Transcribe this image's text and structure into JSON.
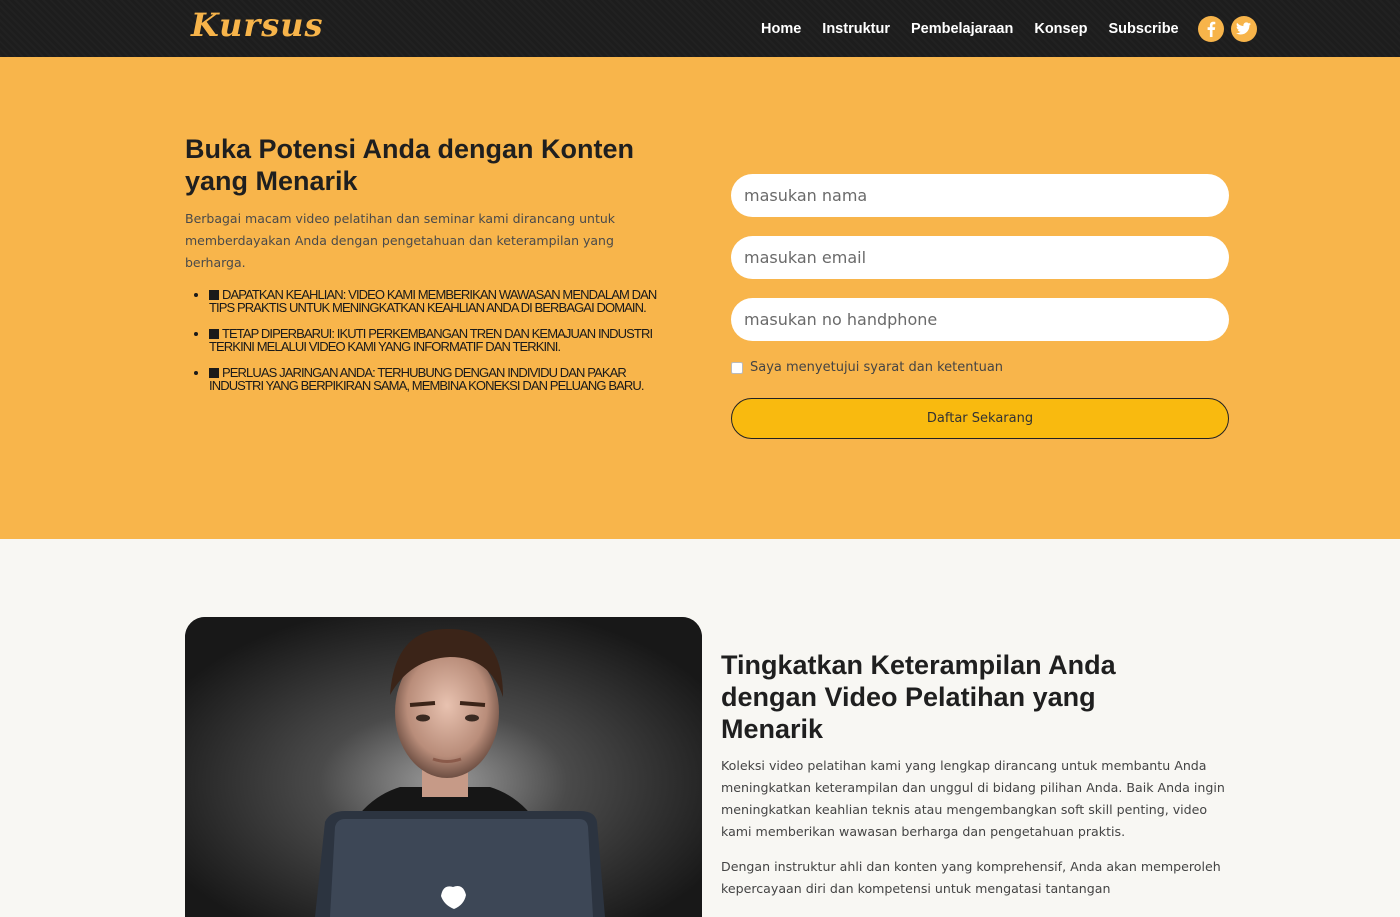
{
  "nav": {
    "logo": "Kursus",
    "links": [
      "Home",
      "Instruktur",
      "Pembelajaraan",
      "Konsep",
      "Subscribe"
    ],
    "social": [
      "facebook-icon",
      "twitter-icon"
    ]
  },
  "hero": {
    "title": "Buka Potensi Anda dengan Konten yang Menarik",
    "text": "Berbagai macam video pelatihan dan seminar kami dirancang untuk memberdayakan Anda dengan pengetahuan dan keterampilan yang berharga.",
    "list": [
      "DAPATKAN KEAHLIAN: VIDEO KAMI MEMBERIKAN WAWASAN MENDALAM DAN TIPS PRAKTIS UNTUK MENINGKATKAN KEAHLIAN ANDA DI BERBAGAI DOMAIN.",
      "TETAP DIPERBARUI: IKUTI PERKEMBANGAN TREN DAN KEMAJUAN INDUSTRI TERKINI MELALUI VIDEO KAMI YANG INFORMATIF DAN TERKINI.",
      "PERLUAS JARINGAN ANDA: TERHUBUNG DENGAN INDIVIDU DAN PAKAR INDUSTRI YANG BERPIKIRAN SAMA, MEMBINA KONEKSI DAN PELUANG BARU."
    ]
  },
  "form": {
    "name_placeholder": "masukan nama",
    "email_placeholder": "masukan email",
    "phone_placeholder": "masukan no handphone",
    "terms_label": "Saya menyetujui syarat dan ketentuan",
    "submit_label": "Daftar Sekarang"
  },
  "section2": {
    "title": "Tingkatkan Keterampilan Anda dengan Video Pelatihan yang Menarik",
    "p1": "Koleksi video pelatihan kami yang lengkap dirancang untuk membantu Anda meningkatkan keterampilan dan unggul di bidang pilihan Anda. Baik Anda ingin meningkatkan keahlian teknis atau mengembangkan soft skill penting, video kami memberikan wawasan berharga dan pengetahuan praktis.",
    "p2": "Dengan instruktur ahli dan konten yang komprehensif, Anda akan memperoleh kepercayaan diri dan kompetensi untuk mengatasi tantangan"
  },
  "colors": {
    "accent": "#f8b54b",
    "nav_bg": "#1d1d1d",
    "button": "#f9ba0f"
  }
}
